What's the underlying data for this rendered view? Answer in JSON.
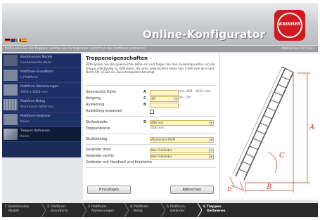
{
  "header": {
    "title": "Online-Konfigurator",
    "logo_text": "KRINNER"
  },
  "instruction": {
    "left": "Definieren Sie die Treppen, welche Sie im folgenden Schritt an der Plattform platzieren",
    "right": "Abbrechen mit [ESC]"
  },
  "sidebar": {
    "items": [
      {
        "title": "Bestehendes Modell",
        "sub": "Sonderkonstruktion"
      },
      {
        "title": "Plattform-Grundform",
        "sub": "L-Plattform"
      },
      {
        "title": "Plattform-Abmessungen",
        "sub": "4000 x 4000 mm"
      },
      {
        "title": "Plattform-Belag",
        "sub": "Aluminium-Gitterrost"
      },
      {
        "title": "Plattform-Geländer",
        "sub": "Keine"
      },
      {
        "title": "Treppen definieren",
        "sub": "Keine"
      }
    ]
  },
  "form": {
    "title": "Treppeneigenschaften",
    "description": "Bitte geben Sie die gewünschte Höhe ein und folgen Sie den Auswahlpunkten um die Treppe vollständig zu definieren. Ab einer senkrechten Höhe von 3.000 mm wird laut Norm EN 14122 ein Zwischenpodest benötigt.",
    "height_label": "Senkrechte Höhe",
    "height_key": "A",
    "height_value": "",
    "height_unit": "mm",
    "height_range": "404 - 4242 mm",
    "incline_label": "Neigung",
    "incline_key": "C",
    "incline_value": "45°",
    "incline_range": "30 - 70°",
    "projection_label": "Ausladung",
    "projection_key": "B",
    "projection_value": "",
    "adjust_label": "Ausladung anpassen",
    "step_width_label": "Stufenbreite",
    "step_width_key": "D",
    "step_width_value": "600 mm",
    "stair_width_label": "Treppenbreite",
    "stair_width_value": "658 mm",
    "step_cover_label": "Stufenbelag",
    "step_cover_value": "Aluminium-Profil",
    "rail_left_label": "Geländer links",
    "rail_left_value": "Kein Geländer",
    "rail_right_label": "Geländer rechts",
    "rail_right_value": "Kein Geländer",
    "rail_note": "Geländer mit Handlauf und Knieleiste",
    "add_button": "Hinzufügen",
    "cancel_button": "Abbrechen"
  },
  "drawing": {
    "labels": [
      "A",
      "B",
      "C",
      "D"
    ]
  },
  "steps": [
    {
      "num": "1",
      "t1": "Bestehendes",
      "t2": "Modell"
    },
    {
      "num": "2",
      "t1": "Plattform-",
      "t2": "Grundform"
    },
    {
      "num": "3",
      "t1": "Plattform-",
      "t2": "Abmessungen"
    },
    {
      "num": "4",
      "t1": "Plattform-",
      "t2": "Belag"
    },
    {
      "num": "5",
      "t1": "Plattform-",
      "t2": "Geländer"
    },
    {
      "num": "6",
      "t1": "Treppen",
      "t2": "Definieren"
    }
  ],
  "colors": {
    "sidebar": "#1a2c57",
    "input_highlight": "#fff6c8",
    "accent_red": "#d11a1f",
    "drawing_label": "#c0392b"
  }
}
